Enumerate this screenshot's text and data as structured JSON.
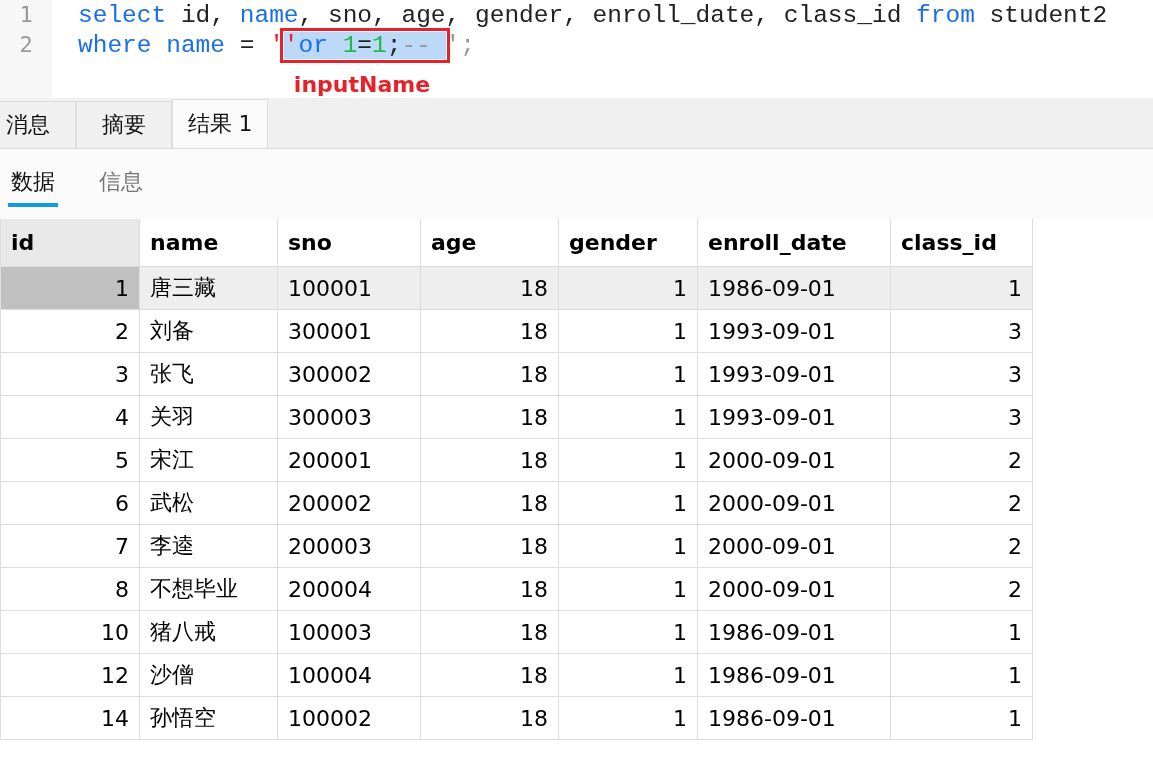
{
  "editor": {
    "lines": [
      {
        "number": "1",
        "segments": [
          {
            "highlighted": false,
            "tokens": [
              {
                "kind": "keyword",
                "text": "select"
              },
              {
                "kind": "plain",
                "text": " id, "
              },
              {
                "kind": "keyword",
                "text": "name"
              },
              {
                "kind": "plain",
                "text": ", sno, age, gender, enroll_date, class_id "
              },
              {
                "kind": "keyword",
                "text": "from"
              },
              {
                "kind": "plain",
                "text": " student2"
              }
            ]
          }
        ]
      },
      {
        "number": "2",
        "segments": [
          {
            "highlighted": false,
            "tokens": [
              {
                "kind": "keyword",
                "text": "where "
              },
              {
                "kind": "keyword",
                "text": "name"
              },
              {
                "kind": "plain",
                "text": " = "
              },
              {
                "kind": "string",
                "text": "'"
              }
            ]
          },
          {
            "highlighted": true,
            "tokens": [
              {
                "kind": "string",
                "text": "'"
              },
              {
                "kind": "keyword",
                "text": "or "
              },
              {
                "kind": "number",
                "text": "1"
              },
              {
                "kind": "plain",
                "text": "="
              },
              {
                "kind": "number",
                "text": "1"
              },
              {
                "kind": "plain",
                "text": ";"
              },
              {
                "kind": "comment",
                "text": "-- "
              }
            ]
          },
          {
            "highlighted": false,
            "tokens": [
              {
                "kind": "comment",
                "text": "';"
              }
            ]
          }
        ]
      }
    ],
    "annotation": "inputName"
  },
  "tabs": [
    {
      "label": "消息",
      "selected": false
    },
    {
      "label": "摘要",
      "selected": false
    },
    {
      "label": "结果 1",
      "selected": true
    }
  ],
  "subtabs": [
    {
      "label": "数据",
      "selected": true
    },
    {
      "label": "信息",
      "selected": false
    }
  ],
  "table": {
    "columns": [
      {
        "label": "id",
        "kind": "number"
      },
      {
        "label": "name",
        "kind": "text"
      },
      {
        "label": "sno",
        "kind": "text"
      },
      {
        "label": "age",
        "kind": "number"
      },
      {
        "label": "gender",
        "kind": "number"
      },
      {
        "label": "enroll_date",
        "kind": "text"
      },
      {
        "label": "class_id",
        "kind": "number"
      }
    ],
    "rows": [
      {
        "selected": true,
        "cells": [
          "1",
          "唐三藏",
          "100001",
          "18",
          "1",
          "1986-09-01",
          "1"
        ]
      },
      {
        "selected": false,
        "cells": [
          "2",
          "刘备",
          "300001",
          "18",
          "1",
          "1993-09-01",
          "3"
        ]
      },
      {
        "selected": false,
        "cells": [
          "3",
          "张飞",
          "300002",
          "18",
          "1",
          "1993-09-01",
          "3"
        ]
      },
      {
        "selected": false,
        "cells": [
          "4",
          "关羽",
          "300003",
          "18",
          "1",
          "1993-09-01",
          "3"
        ]
      },
      {
        "selected": false,
        "cells": [
          "5",
          "宋江",
          "200001",
          "18",
          "1",
          "2000-09-01",
          "2"
        ]
      },
      {
        "selected": false,
        "cells": [
          "6",
          "武松",
          "200002",
          "18",
          "1",
          "2000-09-01",
          "2"
        ]
      },
      {
        "selected": false,
        "cells": [
          "7",
          "李逵",
          "200003",
          "18",
          "1",
          "2000-09-01",
          "2"
        ]
      },
      {
        "selected": false,
        "cells": [
          "8",
          "不想毕业",
          "200004",
          "18",
          "1",
          "2000-09-01",
          "2"
        ]
      },
      {
        "selected": false,
        "cells": [
          "10",
          "猪八戒",
          "100003",
          "18",
          "1",
          "1986-09-01",
          "1"
        ]
      },
      {
        "selected": false,
        "cells": [
          "12",
          "沙僧",
          "100004",
          "18",
          "1",
          "1986-09-01",
          "1"
        ]
      },
      {
        "selected": false,
        "cells": [
          "14",
          "孙悟空",
          "100002",
          "18",
          "1",
          "1986-09-01",
          "1"
        ]
      }
    ]
  }
}
